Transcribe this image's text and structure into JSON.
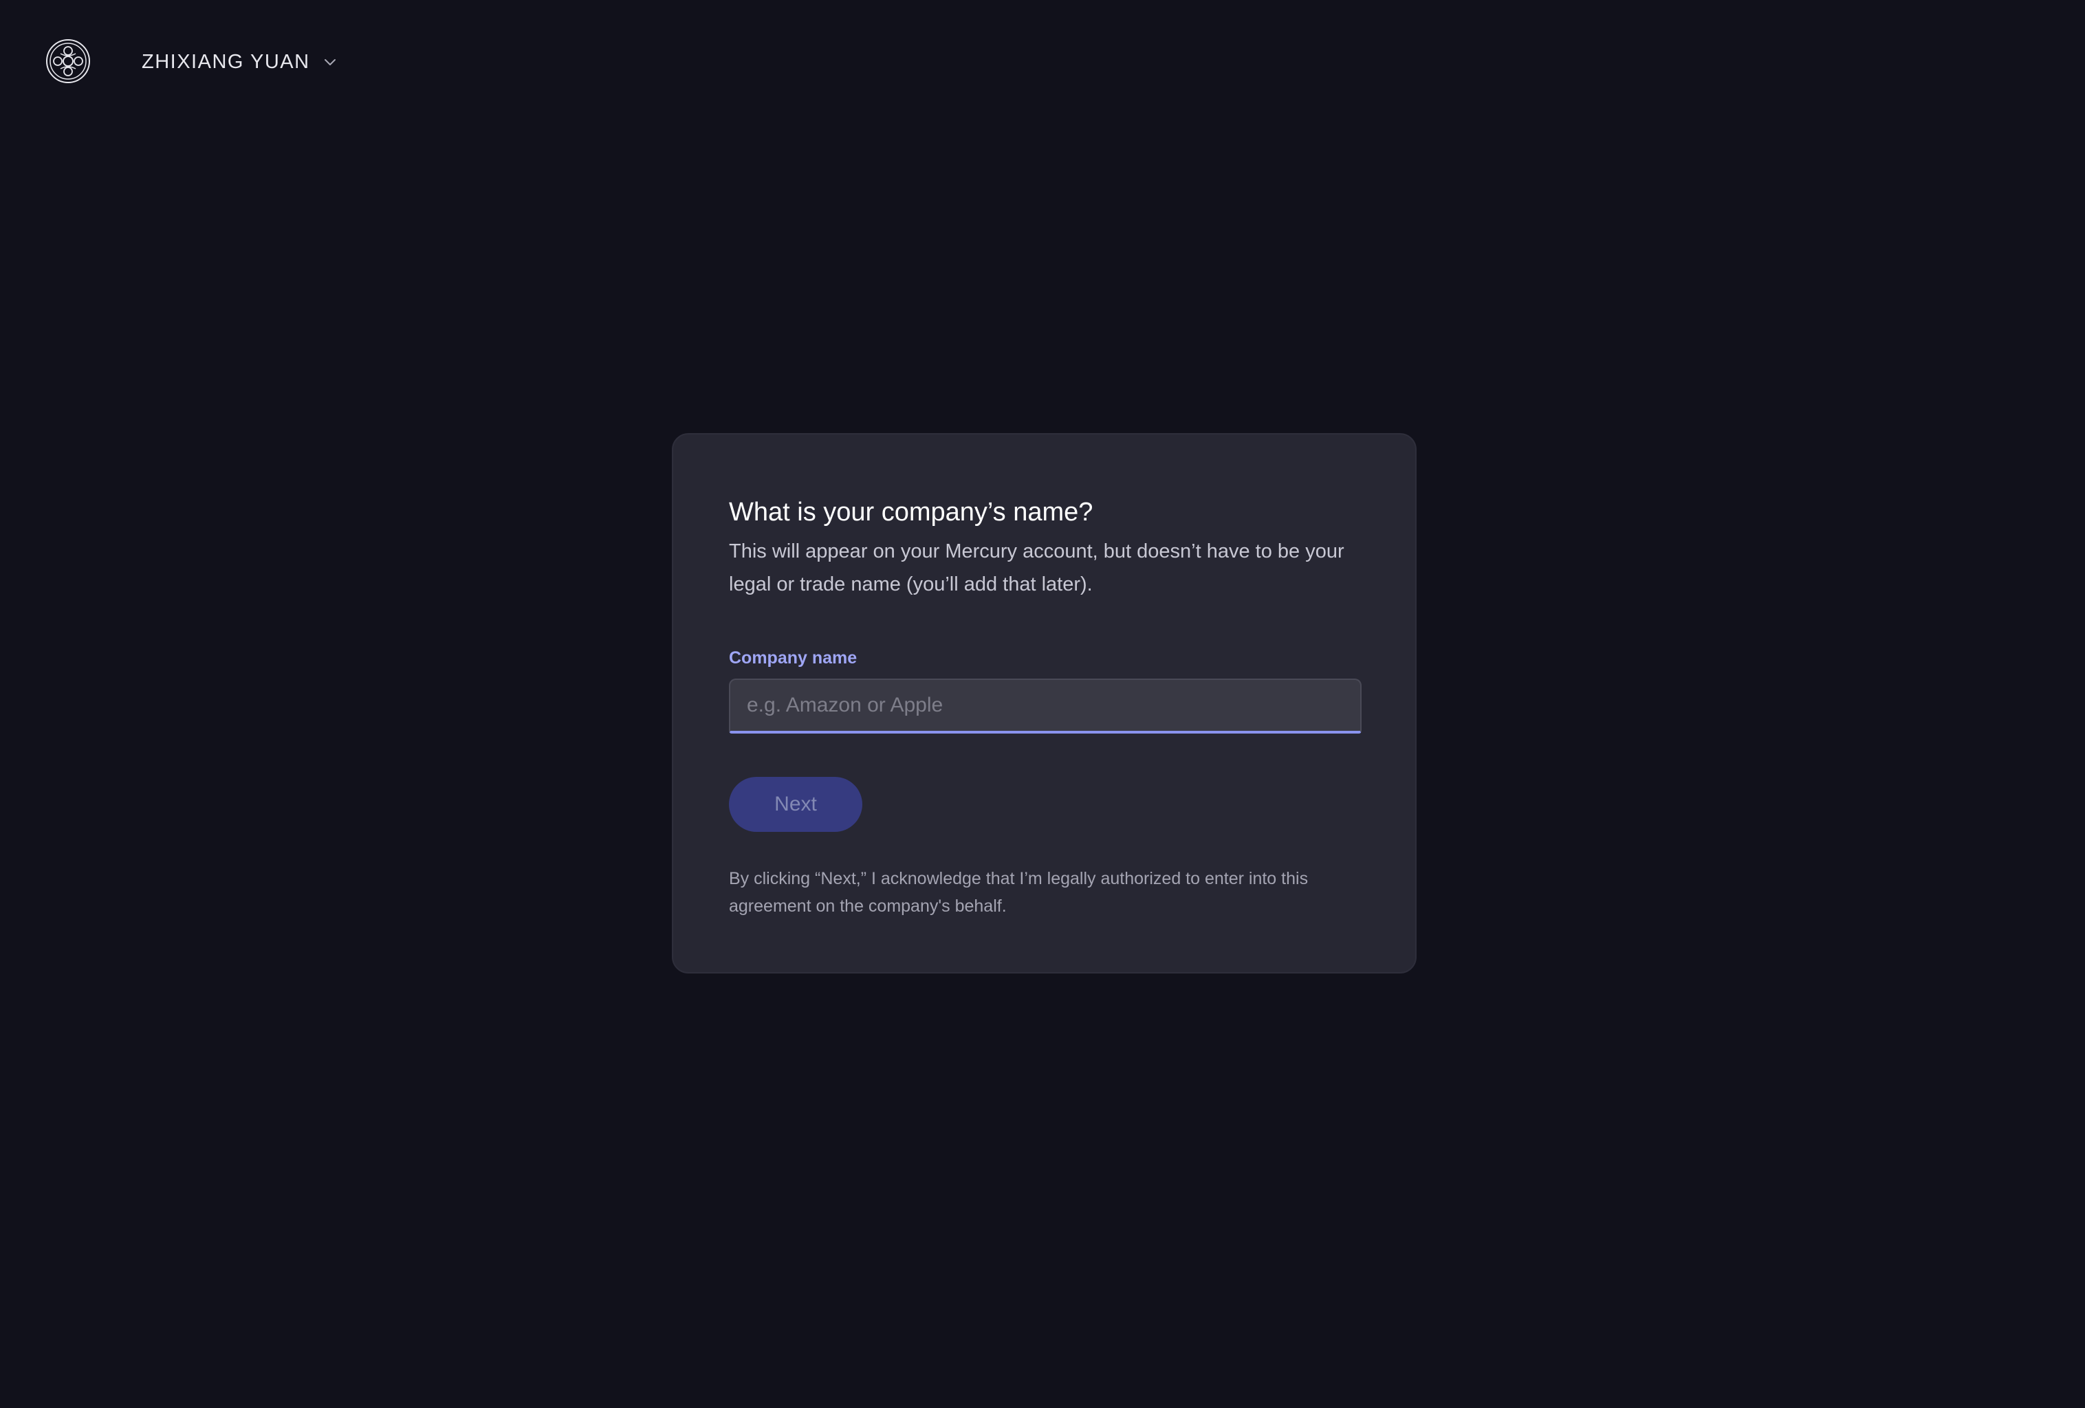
{
  "header": {
    "account_name": "ZHIXIANG YUAN",
    "logo_icon": "mercury-logo-icon",
    "dropdown_icon": "chevron-down-icon"
  },
  "form": {
    "heading": "What is your company’s name?",
    "subtitle": "This will appear on your Mercury account, but doesn’t have to be your legal or trade name (you’ll add that later).",
    "field_label": "Company name",
    "field_value": "",
    "field_placeholder": "e.g. Amazon or Apple",
    "next_label": "Next",
    "legal_text": "By clicking “Next,” I acknowledge that I’m legally authorized to enter into this agreement on the company's behalf."
  },
  "colors": {
    "background": "#11111b",
    "card": "#272733",
    "accent": "#9fa6f5",
    "button": "#363b80"
  }
}
